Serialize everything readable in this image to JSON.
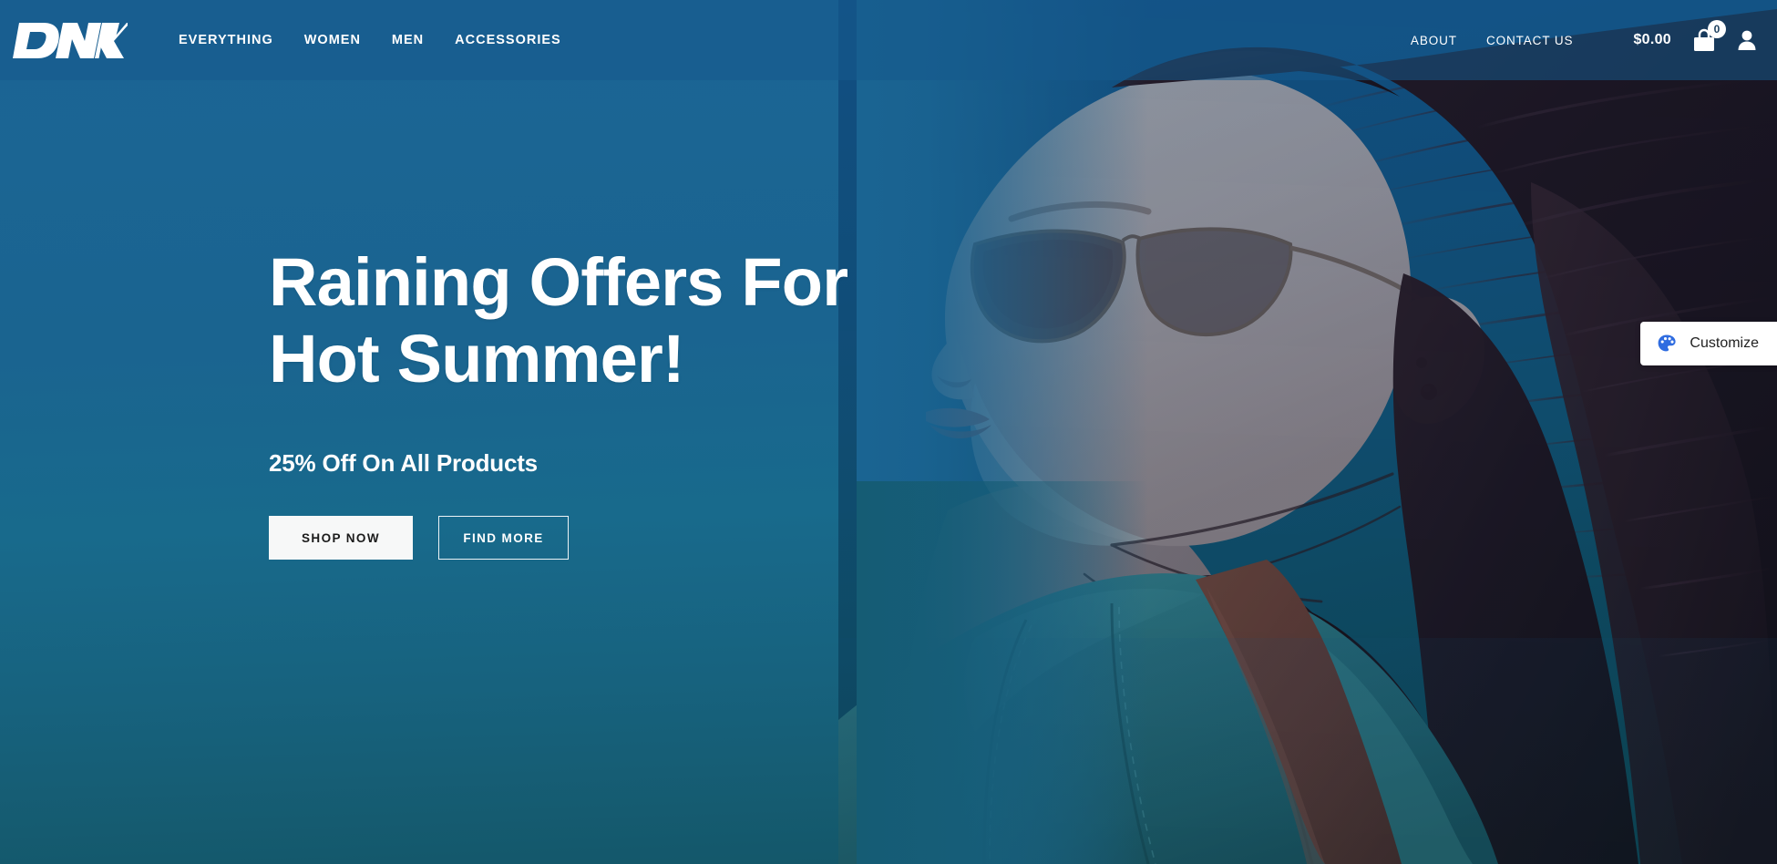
{
  "site": {
    "logo_text": "DNK",
    "brand_color": "#ffffff"
  },
  "header": {
    "primary_nav": [
      {
        "label": "EVERYTHING",
        "name": "nav-everything"
      },
      {
        "label": "WOMEN",
        "name": "nav-women"
      },
      {
        "label": "MEN",
        "name": "nav-men"
      },
      {
        "label": "ACCESSORIES",
        "name": "nav-accessories"
      }
    ],
    "secondary_nav": [
      {
        "label": "ABOUT",
        "name": "nav-about"
      },
      {
        "label": "CONTACT US",
        "name": "nav-contact-us"
      }
    ],
    "cart": {
      "price": "$0.00",
      "count": "0",
      "icon": "shopping-bag-icon"
    },
    "account": {
      "icon": "user-icon"
    },
    "background_color": "#1d5f8e"
  },
  "hero": {
    "title_line1": "Raining Offers For",
    "title_line2": "Hot Summer!",
    "subtitle": "25% Off On All Products",
    "buttons": [
      {
        "label": "SHOP NOW",
        "style": "primary",
        "name": "shop-now-button"
      },
      {
        "label": "FIND MORE",
        "style": "outline",
        "name": "find-more-button"
      }
    ],
    "background_color_top": "#1b6495",
    "background_color_bottom": "#135567",
    "image_description": "Woman with sunglasses and long windblown hair in a teal denim jacket against a blue sky"
  },
  "customize_widget": {
    "label": "Customize",
    "icon": "palette-icon",
    "icon_color": "#2f6ce0",
    "background_color": "#ffffff"
  }
}
